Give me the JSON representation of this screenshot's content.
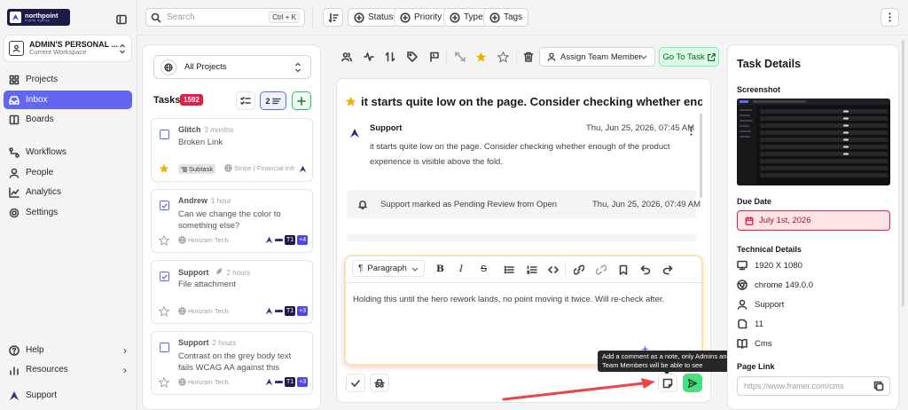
{
  "brand": {
    "name": "northpoint",
    "tagline": "digital agency"
  },
  "workspace": {
    "name": "ADMIN'S PERSONAL ...",
    "subtitle": "Current Workspace"
  },
  "nav": {
    "projects": "Projects",
    "inbox": "Inbox",
    "boards": "Boards",
    "workflows": "Workflows",
    "people": "People",
    "analytics": "Analytics",
    "settings": "Settings",
    "help": "Help",
    "resources": "Resources",
    "user": "Support"
  },
  "topbar": {
    "search_placeholder": "Search",
    "shortcut": "Ctrl + K",
    "filters": [
      "Status",
      "Priority",
      "Type",
      "Tags"
    ]
  },
  "tasks_panel": {
    "project_select": "All Projects",
    "title": "Tasks",
    "count": "1592",
    "view_count": "2"
  },
  "task_cards": [
    {
      "title": "Glitch",
      "time": "3 months",
      "body": "Broken Link",
      "subtask": "Subtask",
      "project": "Stripe | Financial Infr",
      "starred": true
    },
    {
      "title": "Andrew",
      "time": "1 hour",
      "body": "Can we change the color to something else?",
      "project": "Horizam Tech",
      "badge_tag": "T1",
      "badge_more": "+4",
      "starred": false
    },
    {
      "title": "Support",
      "time": "2 hours",
      "body": "File attachment",
      "project": "Horizam Tech",
      "badge_tag": "T1",
      "badge_more": "+3",
      "starred": false
    },
    {
      "title": "Support",
      "time": "2 hours",
      "body": "Contrast on the grey body text fails WCAG AA against this background...",
      "project": "Horizam Tech",
      "badge_tag": "T1",
      "badge_more": "+3",
      "starred": false
    }
  ],
  "detail": {
    "assign_label": "Assign Team Member",
    "goto_label": "Go To Task",
    "title": "it starts quite low on the page. Consider checking whether enough...",
    "comment": {
      "author": "Support",
      "date": "Thu, Jun 25, 2026, 07:45 AM",
      "text": "it starts quite low on the page. Consider checking whether enough of the product experience is visible above the fold."
    },
    "activity": {
      "text": "Support marked as Pending Review from Open",
      "date": "Thu, Jun 25, 2026, 07:49 AM"
    },
    "editor": {
      "block_type": "Paragraph",
      "draft": "Holding this until the hero rework lands, no point moving it twice. Will re-check after."
    },
    "tooltip": "Add a comment as a note, only Admins and Team Members will be able to see"
  },
  "task_details": {
    "title": "Task Details",
    "screenshot_label": "Screenshot",
    "due_label": "Due Date",
    "due_value": "July 1st, 2026",
    "tech_label": "Technical Details",
    "resolution": "1920 X 1080",
    "browser": "chrome 149.0.0",
    "user": "Support",
    "os_version": "11",
    "cms": "Cms",
    "page_link_label": "Page Link",
    "page_link_placeholder": "https://www.framer.com/cms"
  },
  "colors": {
    "accent": "#6366f1",
    "danger": "#e11d48",
    "success": "#22c55e",
    "star": "#eab308"
  }
}
